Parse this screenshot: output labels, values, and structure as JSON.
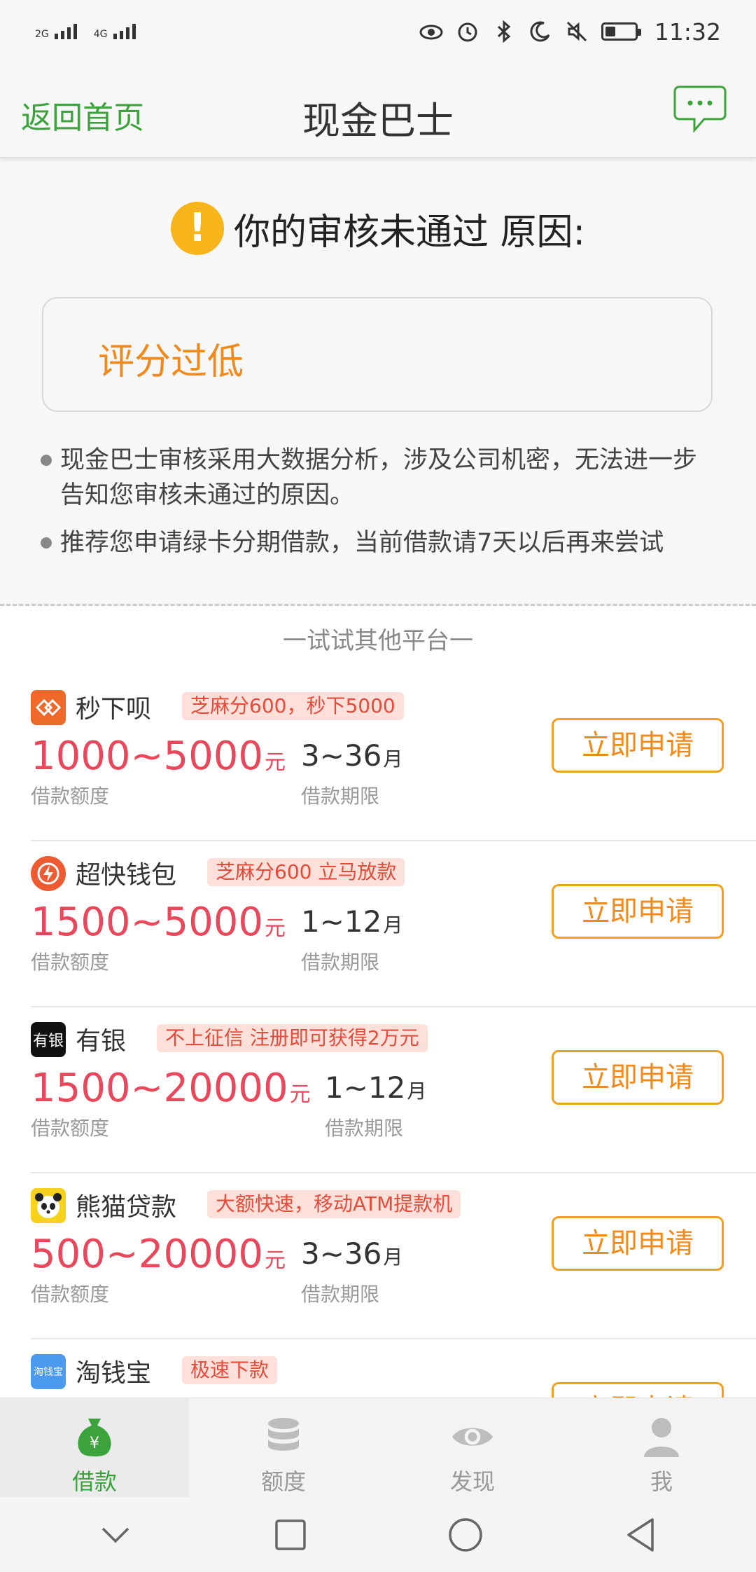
{
  "status_bar": {
    "network1": "2G",
    "network2": "4G",
    "time": "11:32",
    "battery_level": 0.35
  },
  "header": {
    "back_label": "返回首页",
    "title": "现金巴士"
  },
  "review": {
    "status_text": "你的审核未通过 原因:",
    "reason": "评分过低",
    "notes": [
      "现金巴士审核采用大数据分析，涉及公司机密，无法进一步告知您审核未通过的原因。",
      "推荐您申请绿卡分期借款，当前借款请7天以后再来尝试"
    ]
  },
  "platforms": {
    "section_title": "一试试其他平台一",
    "items": [
      {
        "name": "秒下呗",
        "tag": "芝麻分600，秒下5000",
        "amount": "1000~5000",
        "amount_unit": "元",
        "amount_label": "借款额度",
        "term": "3~36",
        "term_unit": "月",
        "term_label": "借款期限",
        "apply_label": "立即申请",
        "logo_color": "#ef6a2a"
      },
      {
        "name": "超快钱包",
        "tag": "芝麻分600 立马放款",
        "amount": "1500~5000",
        "amount_unit": "元",
        "amount_label": "借款额度",
        "term": "1~12",
        "term_unit": "月",
        "term_label": "借款期限",
        "apply_label": "立即申请",
        "logo_color": "#ee5a32"
      },
      {
        "name": "有银",
        "tag": "不上征信 注册即可获得2万元",
        "amount": "1500~20000",
        "amount_unit": "元",
        "amount_label": "借款额度",
        "term": "1~12",
        "term_unit": "月",
        "term_label": "借款期限",
        "apply_label": "立即申请",
        "logo_text": "有银",
        "logo_color": "#111111"
      },
      {
        "name": "熊猫贷款",
        "tag": "大额快速，移动ATM提款机",
        "amount": "500~20000",
        "amount_unit": "元",
        "amount_label": "借款额度",
        "term": "3~36",
        "term_unit": "月",
        "term_label": "借款期限",
        "apply_label": "立即申请",
        "logo_color": "#f7d21c"
      },
      {
        "name": "淘钱宝",
        "tag": "极速下款",
        "amount": "",
        "amount_unit": "",
        "amount_label": "",
        "term": "",
        "term_unit": "",
        "term_label": "",
        "apply_label": "立即申请",
        "logo_text": "淘钱宝",
        "logo_color": "#4c9af0"
      }
    ]
  },
  "tabs": [
    {
      "label": "借款",
      "icon": "money-bag-icon",
      "active": true
    },
    {
      "label": "额度",
      "icon": "coin-stack-icon",
      "active": false
    },
    {
      "label": "发现",
      "icon": "eye-icon",
      "active": false
    },
    {
      "label": "我",
      "icon": "person-icon",
      "active": false
    }
  ],
  "colors": {
    "accent_green": "#3ca33c",
    "amount_red": "#e9485c",
    "apply_orange": "#f08a1c",
    "warning_yellow": "#f7b51b"
  }
}
